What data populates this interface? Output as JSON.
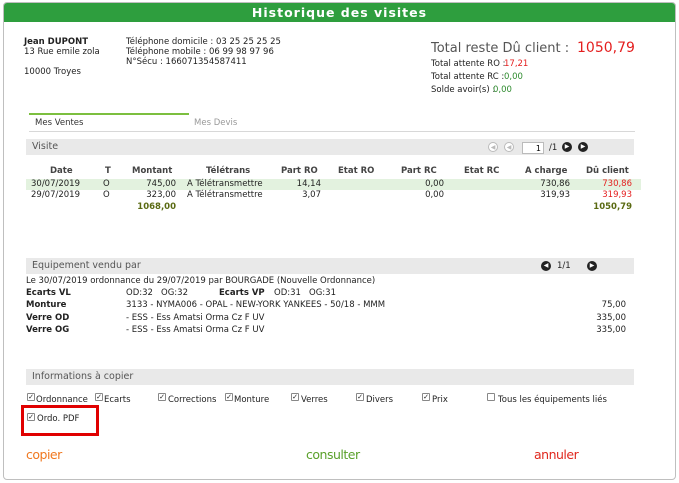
{
  "window": {
    "title": "Historique des visites"
  },
  "client": {
    "name": "Jean DUPONT",
    "address1": "13 Rue emile zola",
    "address2": "10000 Troyes",
    "phone_home": "Téléphone domicile : 03 25 25 25 25",
    "phone_mobile": "Téléphone mobile : 06 99 98 97 96",
    "secu": "N°Sécu : 166071354587411"
  },
  "totals": {
    "total_label": "Total reste Dû client :",
    "total_value": "1050,79",
    "ro_label": "Total attente RO :",
    "ro_value": "17,21",
    "rc_label": "Total attente RC :",
    "rc_value": "0,00",
    "avoir_label": "Solde avoir(s) :",
    "avoir_value": "0,00"
  },
  "tabs": [
    {
      "label": "Mes Ventes",
      "active": true
    },
    {
      "label": "Mes Devis",
      "active": false
    }
  ],
  "visite": {
    "title": "Visite",
    "pager": {
      "current": "1",
      "total": "/1"
    },
    "headers": [
      "Date",
      "T",
      "Montant",
      "Télétrans",
      "Part RO",
      "Etat RO",
      "Part RC",
      "Etat RC",
      "A charge",
      "Dû client"
    ],
    "rows": [
      {
        "date": "30/07/2019",
        "t": "O",
        "montant": "745,00",
        "teletrans": "A Télétransmettre",
        "part_ro": "14,14",
        "etat_ro": "",
        "part_rc": "0,00",
        "etat_rc": "",
        "a_charge": "730,86",
        "du_client": "730,86"
      },
      {
        "date": "29/07/2019",
        "t": "O",
        "montant": "323,00",
        "teletrans": "A Télétransmettre",
        "part_ro": "3,07",
        "etat_ro": "",
        "part_rc": "0,00",
        "etat_rc": "",
        "a_charge": "319,93",
        "du_client": "319,93"
      }
    ],
    "total_montant": "1068,00",
    "total_du": "1050,79"
  },
  "equipement": {
    "title": "Equipement vendu par",
    "pager": "1/1",
    "summary": "Le 30/07/2019 ordonnance du 29/07/2019 par BOURGADE (Nouvelle Ordonnance)",
    "ecarts_vl_label": "Ecarts VL",
    "ecarts_vl_values": "OD:32   OG:32",
    "ecarts_vp_label": "Ecarts VP",
    "ecarts_vp_values": "OD:31   OG:31",
    "lines": [
      {
        "label": "Monture",
        "desc": "3133 - NYMA006 - OPAL - NEW-YORK YANKEES - 50/18 - MMM",
        "price": "75,00"
      },
      {
        "label": "Verre OD",
        "desc": "- ESS - Ess Amatsi Orma Cz F UV",
        "price": "335,00"
      },
      {
        "label": "Verre OG",
        "desc": "- ESS - Ess Amatsi Orma Cz F UV",
        "price": "335,00"
      }
    ]
  },
  "copy_info": {
    "title": "Informations à copier",
    "options": [
      {
        "label": "Ordonnance",
        "checked": true
      },
      {
        "label": "Ecarts",
        "checked": true
      },
      {
        "label": "Corrections",
        "checked": true
      },
      {
        "label": "Monture",
        "checked": true
      },
      {
        "label": "Verres",
        "checked": true
      },
      {
        "label": "Divers",
        "checked": true
      },
      {
        "label": "Prix",
        "checked": true
      },
      {
        "label": "Tous les équipements liés",
        "checked": false
      },
      {
        "label": "Ordo. PDF",
        "checked": true
      }
    ]
  },
  "actions": {
    "copier": "copier",
    "consulter": "consulter",
    "annuler": "annuler"
  },
  "colors": {
    "header_green": "#2e9e3e",
    "total_red": "#e41e1e",
    "copier_orange": "#f07820",
    "consulter_green": "#5aa02a",
    "annuler_red": "#e0281e",
    "highlight_red": "#e00000"
  }
}
